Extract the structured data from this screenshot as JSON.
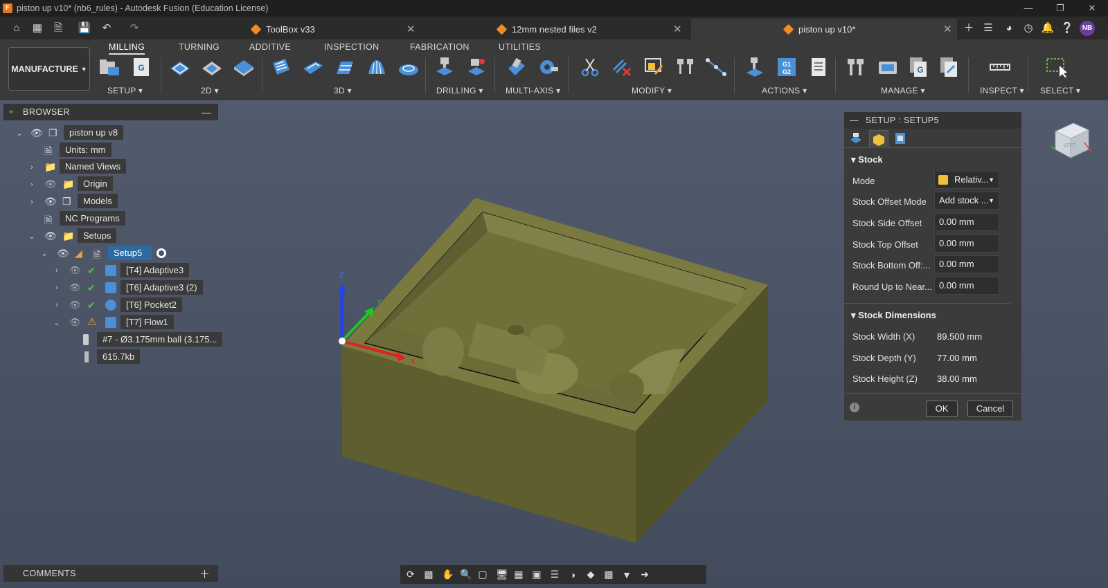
{
  "window": {
    "title": "piston up v10* (nb6_rules) - Autodesk Fusion (Education License)",
    "app_icon_letter": "F"
  },
  "tabs": [
    {
      "label": "ToolBox v33",
      "active": false
    },
    {
      "label": "12mm nested files v2",
      "active": false
    },
    {
      "label": "piston up v10*",
      "active": true
    }
  ],
  "user": {
    "initials": "NB"
  },
  "ribbon": {
    "workspace": "MANUFACTURE",
    "tabs": [
      "MILLING",
      "TURNING",
      "ADDITIVE",
      "INSPECTION",
      "FABRICATION",
      "UTILITIES"
    ],
    "active_tab": "MILLING",
    "groups": [
      "SETUP",
      "2D",
      "3D",
      "DRILLING",
      "MULTI-AXIS",
      "MODIFY",
      "ACTIONS",
      "MANAGE",
      "INSPECT",
      "SELECT"
    ]
  },
  "browser": {
    "title": "BROWSER",
    "root": "piston up v8",
    "units": "Units: mm",
    "nodes": [
      "Named Views",
      "Origin",
      "Models",
      "NC Programs",
      "Setups"
    ],
    "setup": "Setup5",
    "operations": [
      "[T4] Adaptive3",
      "[T6] Adaptive3 (2)",
      "[T6] Pocket2",
      "[T7] Flow1"
    ],
    "tool": "#7 - Ø3.175mm ball (3.175...",
    "file_size": "615.7kb"
  },
  "comments": {
    "title": "COMMENTS"
  },
  "setup_dialog": {
    "title": "SETUP : SETUP5",
    "stock_section": "Stock",
    "fields": [
      {
        "label": "Mode",
        "value": "Relativ..."
      },
      {
        "label": "Stock Offset Mode",
        "value": "Add stock ..."
      },
      {
        "label": "Stock Side Offset",
        "value": "0.00 mm"
      },
      {
        "label": "Stock Top Offset",
        "value": "0.00 mm"
      },
      {
        "label": "Stock Bottom Off:...",
        "value": "0.00 mm"
      },
      {
        "label": "Round Up to Near...",
        "value": "0.00 mm"
      }
    ],
    "dimensions_section": "Stock Dimensions",
    "dimensions": [
      {
        "label": "Stock Width (X)",
        "value": "89.500 mm"
      },
      {
        "label": "Stock Depth (Y)",
        "value": "77.00 mm"
      },
      {
        "label": "Stock Height (Z)",
        "value": "38.00 mm"
      }
    ],
    "ok": "OK",
    "cancel": "Cancel"
  },
  "viewcube": {
    "face": "LEFT"
  },
  "axes": {
    "x": "X",
    "y": "Y",
    "z": "Z"
  },
  "colors": {
    "stock": "#5c5c2e",
    "stock_top": "#7d7d45",
    "accent": "#2d6aa0",
    "tab_icon": "#f08a24"
  }
}
